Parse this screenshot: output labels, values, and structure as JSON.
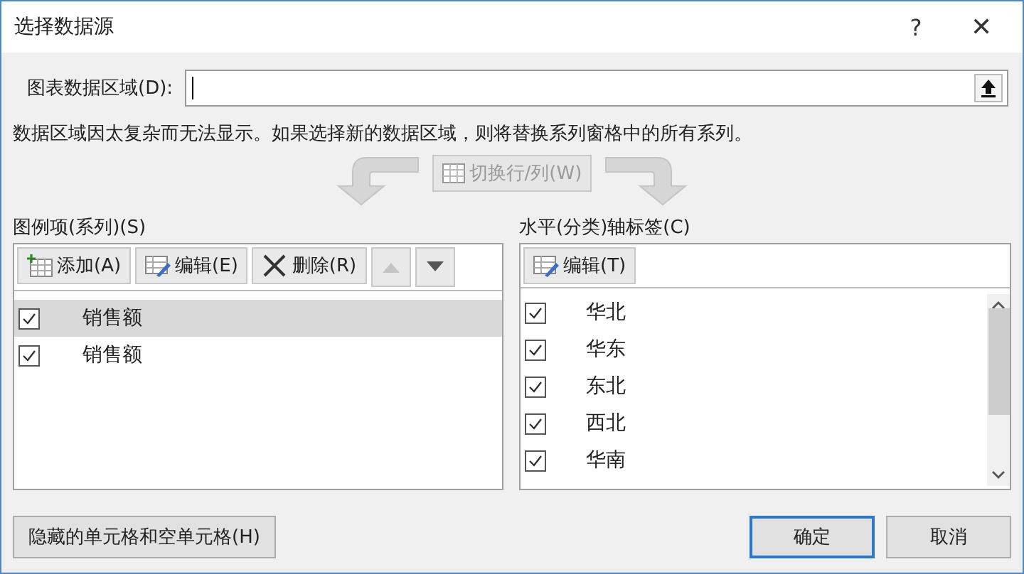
{
  "window": {
    "title": "选择数据源",
    "help": "?",
    "close": "✕"
  },
  "range": {
    "label": "图表数据区域(D):"
  },
  "message": "数据区域因太复杂而无法显示。如果选择新的数据区域，则将替换系列窗格中的所有系列。",
  "switch_button": {
    "label": "切换行/列(W)",
    "disabled": true
  },
  "legend": {
    "title": "图例项(系列)(S)",
    "toolbar": [
      {
        "kind": "add",
        "label": "添加(A)"
      },
      {
        "kind": "edit",
        "label": "编辑(E)"
      },
      {
        "kind": "delete",
        "label": "删除(R)"
      },
      {
        "kind": "up",
        "disabled": true
      },
      {
        "kind": "down",
        "disabled": false
      }
    ],
    "items": [
      {
        "label": "销售额",
        "checked": true,
        "selected": true
      },
      {
        "label": "销售额",
        "checked": true,
        "selected": false
      }
    ]
  },
  "axis": {
    "title": "水平(分类)轴标签(C)",
    "toolbar": [
      {
        "kind": "edit",
        "label": "编辑(T)"
      }
    ],
    "items": [
      {
        "label": "华北",
        "checked": true
      },
      {
        "label": "华东",
        "checked": true
      },
      {
        "label": "东北",
        "checked": true
      },
      {
        "label": "西北",
        "checked": true
      },
      {
        "label": "华南",
        "checked": true
      }
    ]
  },
  "hidden_button": "隐藏的单元格和空单元格(H)",
  "buttons": [
    {
      "label": "确定",
      "default": true
    },
    {
      "label": "取消",
      "default": false
    }
  ]
}
